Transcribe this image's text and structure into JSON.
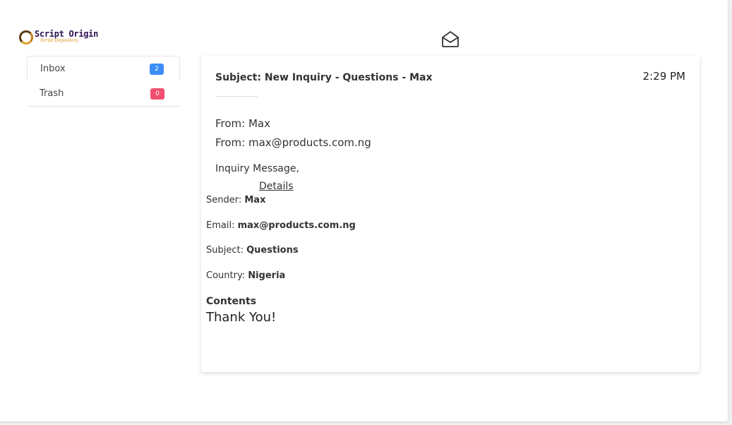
{
  "logo": {
    "title": "Script Origin",
    "subtitle": "Script Depository"
  },
  "sidebar": {
    "folders": [
      {
        "label": "Inbox",
        "count": "2",
        "badge_color": "#3d8ef7"
      },
      {
        "label": "Trash",
        "count": "0",
        "badge_color": "#f0506e"
      }
    ]
  },
  "header": {
    "icon": "envelope-open-icon"
  },
  "message": {
    "subject": "Subject: New Inquiry - Questions - Max",
    "time": "2:29 PM",
    "from_name": "From: Max",
    "from_email": "From: max@products.com.ng",
    "intro": "Inquiry Message,",
    "details_link": "Details",
    "fields": [
      {
        "label": "Sender: ",
        "value": "Max"
      },
      {
        "label": "Email: ",
        "value": "max@products.com.ng"
      },
      {
        "label": "Subject: ",
        "value": "Questions"
      },
      {
        "label": "Country: ",
        "value": "Nigeria"
      }
    ],
    "contents_label": "Contents",
    "contents_body": "Thank You!"
  }
}
